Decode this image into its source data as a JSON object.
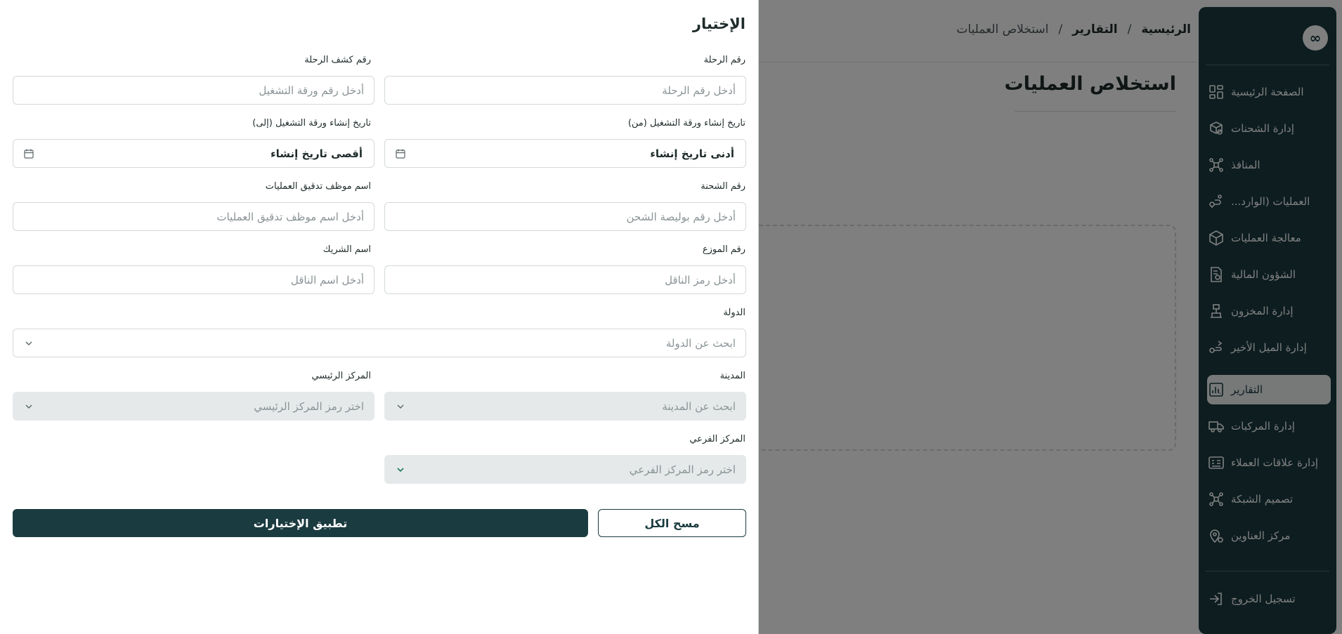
{
  "colors": {
    "primary": "#1a3b40",
    "overlay": "rgba(0,0,0,0.5)",
    "field_border": "#d3d8da",
    "disabled_field": "#e5e9ea"
  },
  "sidebar": {
    "logo_icon": "infinity-icon",
    "items": [
      {
        "label": "الصفحة الرئيسية",
        "icon": "dashboard-icon"
      },
      {
        "label": "إدارة الشحنات",
        "icon": "package-search-icon"
      },
      {
        "label": "المنافذ",
        "icon": "network-icon"
      },
      {
        "label": "العمليات (الوارد...",
        "icon": "route-pin-icon"
      },
      {
        "label": "معالجة العمليات",
        "icon": "box-icon"
      },
      {
        "label": "الشؤون المالية",
        "icon": "finance-document-icon"
      },
      {
        "label": "إدارة المخزون",
        "icon": "warehouse-icon"
      },
      {
        "label": "إدارة الميل الأخير",
        "icon": "last-mile-icon"
      },
      {
        "label": "التقارير",
        "icon": "report-chart-icon",
        "active": true
      },
      {
        "label": "إدارة المركبات",
        "icon": "truck-icon"
      },
      {
        "label": "إدارة علاقات العملاء",
        "icon": "crm-icon"
      },
      {
        "label": "تصميم الشبكة",
        "icon": "network-design-icon"
      },
      {
        "label": "مركز العناوين",
        "icon": "address-pin-icon"
      }
    ],
    "logout": {
      "label": "تسجيل الخروج",
      "icon": "logout-icon"
    }
  },
  "breadcrumb": {
    "home": "الرئيسية",
    "section": "التقارير",
    "current": "استخلاص العمليات",
    "separator": "/"
  },
  "page": {
    "title": "استخلاص العمليات"
  },
  "drawer": {
    "title": "الإختيار",
    "fields": {
      "trip_number": {
        "label": "رقم الرحلة",
        "placeholder": "أدخل رقم الرحلة"
      },
      "trip_sheet_number": {
        "label": "رقم كشف الرحلة",
        "placeholder": "أدخل رقم ورقة التشغيل"
      },
      "created_from": {
        "label": "تاريخ إنشاء ورقة التشغيل (من)",
        "value": "أدنى تاريخ إنشاء"
      },
      "created_to": {
        "label": "تاريخ إنشاء ورقة التشغيل (إلى)",
        "value": "أقصى تاريخ إنشاء"
      },
      "shipment_number": {
        "label": "رقم الشحنة",
        "placeholder": "أدخل رقم بوليصة الشحن"
      },
      "auditor_name": {
        "label": "اسم موظف تدقيق العمليات",
        "placeholder": "أدخل اسم موظف تدقيق العمليات"
      },
      "distributor_number": {
        "label": "رقم الموزع",
        "placeholder": "أدخل رمز الناقل"
      },
      "partner_name": {
        "label": "اسم الشريك",
        "placeholder": "أدخل اسم الناقل"
      },
      "country": {
        "label": "الدولة",
        "placeholder": "ابحث عن الدولة"
      },
      "city": {
        "label": "المدينة",
        "placeholder": "ابحث عن المدينة"
      },
      "main_center": {
        "label": "المركز الرئيسي",
        "placeholder": "اختر رمز المركز الرئيسي"
      },
      "sub_center": {
        "label": "المركز الفرعي",
        "placeholder": "اختر رمز المركز الفرعي"
      }
    },
    "buttons": {
      "clear": "مسح الكل",
      "apply": "تطبيق الإختيارات"
    }
  }
}
